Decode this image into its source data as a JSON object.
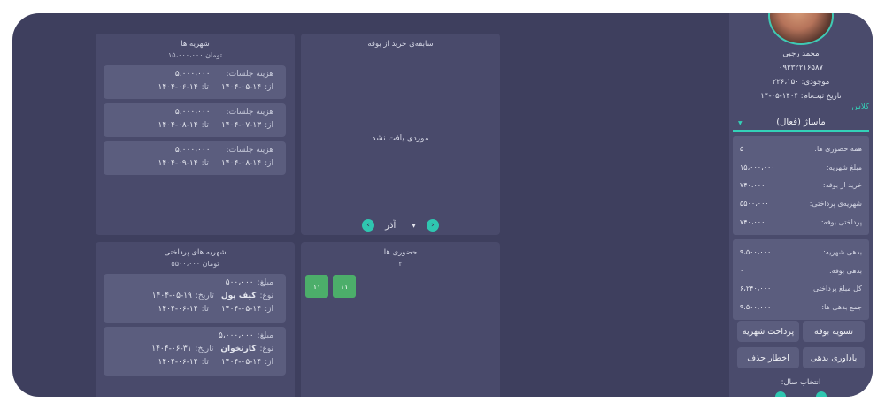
{
  "subscriptions": {
    "title": "شهریه ها",
    "total": "۱۵،۰۰۰،۰۰۰ تومان",
    "items": [
      {
        "cost_label": "هزینه جلسات:",
        "cost": "۵،۰۰۰،۰۰۰",
        "from_label": "از:",
        "from": "۱۴۰۴-۰۵-۱۴",
        "to_label": "تا:",
        "to": "۱۴۰۴-۰۶-۱۴"
      },
      {
        "cost_label": "هزینه جلسات:",
        "cost": "۵،۰۰۰،۰۰۰",
        "from_label": "از:",
        "from": "۱۴۰۴-۰۷-۱۳",
        "to_label": "تا:",
        "to": "۱۴۰۴-۰۸-۱۴"
      },
      {
        "cost_label": "هزینه جلسات:",
        "cost": "۵،۰۰۰،۰۰۰",
        "from_label": "از:",
        "from": "۱۴۰۴-۰۸-۱۴",
        "to_label": "تا:",
        "to": "۱۴۰۴-۰۹-۱۴"
      }
    ]
  },
  "buffet_history": {
    "title": "سابقه‌ی خرید از بوفه",
    "empty_text": "موردی یافت نشد",
    "month": "آذر"
  },
  "paid_subscriptions": {
    "title": "شهریه های پرداختی",
    "total": "۵۵۰۰،۰۰۰ تومان",
    "items": [
      {
        "amount_label": "مبلغ:",
        "amount": "۵۰۰،۰۰۰",
        "type_label": "نوع:",
        "type": "کیف پول",
        "date_label": "تاریخ:",
        "date": "۱۴۰۴-۰۵-۱۹",
        "from_label": "از:",
        "from": "۱۴۰۴-۰۵-۱۴",
        "to_label": "تا:",
        "to": "۱۴۰۴-۰۶-۱۴"
      },
      {
        "amount_label": "مبلغ:",
        "amount": "۵،۰۰۰،۰۰۰",
        "type_label": "نوع:",
        "type": "کارتخوان",
        "date_label": "تاریخ:",
        "date": "۱۴۰۴-۰۶-۳۱",
        "from_label": "از:",
        "from": "۱۴۰۴-۰۵-۱۴",
        "to_label": "تا:",
        "to": "۱۴۰۴-۰۶-۱۴"
      }
    ]
  },
  "attendance": {
    "title": "حضوری ها",
    "count": "۲",
    "days": [
      "۱۱",
      "۱۱"
    ]
  },
  "profile": {
    "name": "محمد رجبی",
    "phone": "۰۹۳۳۲۲۱۶۵۸۷",
    "balance_label": "موجودی:",
    "balance": "۲۲۶،۱۵۰",
    "reg_label": "تاریخ ثبت‌نام:",
    "reg_date": "۱۴۰۴-۰۵-۱۴",
    "class_label": "کلاس",
    "class_value": "ماساژ (فعال)"
  },
  "stats1": [
    {
      "label": "همه حضوری ها:",
      "value": "۵"
    },
    {
      "label": "مبلغ شهریه:",
      "value": "۱۵،۰۰۰،۰۰۰"
    },
    {
      "label": "خرید از بوفه:",
      "value": "۷۴۰،۰۰۰"
    },
    {
      "label": "شهریه‌ی پرداختی:",
      "value": "۵۵۰۰،۰۰۰"
    },
    {
      "label": "پرداختی بوفه:",
      "value": "۷۴۰،۰۰۰"
    }
  ],
  "stats2": [
    {
      "label": "بدهی شهریه:",
      "value": "۹،۵۰۰،۰۰۰"
    },
    {
      "label": "بدهی بوفه:",
      "value": "۰"
    },
    {
      "label": "کل مبلغ پرداختی:",
      "value": "۶،۲۴۰،۰۰۰"
    },
    {
      "label": "جمع بدهی ها:",
      "value": "۹،۵۰۰،۰۰۰"
    }
  ],
  "buttons": {
    "settle_buffet": "تسویه بوفه",
    "pay_tuition": "پرداخت شهریه",
    "debt_reminder": "یادآوری بدهی",
    "delete_warning": "اخطار حذف"
  },
  "year_select_label": "انتخاب سال:",
  "colors": {
    "accent": "#2fc6b0",
    "background": "#3e3f5e",
    "card": "#494a6b",
    "attendance": "#4cae6a"
  }
}
